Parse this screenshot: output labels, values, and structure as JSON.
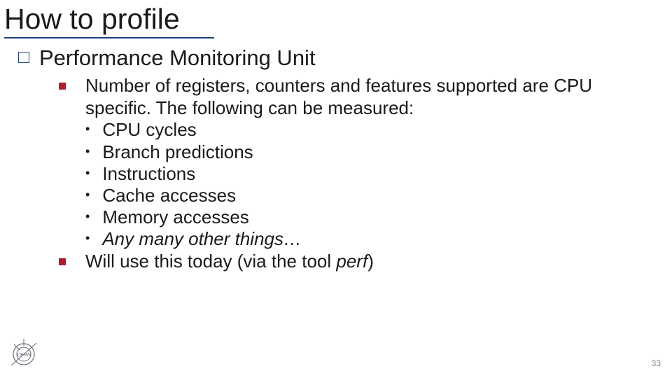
{
  "title": "How to profile",
  "bullets": {
    "lvl1": {
      "text": "Performance Monitoring Unit"
    },
    "lvl2": [
      {
        "text": "Number of registers, counters and features supported are CPU specific. The following can be measured:",
        "sub": [
          {
            "text": "CPU cycles"
          },
          {
            "text": "Branch predictions"
          },
          {
            "text": "Instructions"
          },
          {
            "text": "Cache accesses"
          },
          {
            "text": "Memory accesses"
          },
          {
            "text_italic": "Any many other things…"
          }
        ]
      },
      {
        "text_prefix": "Will use this today (via the tool ",
        "text_italic": "perf",
        "text_suffix": ")"
      }
    ]
  },
  "logo_label": "CERN",
  "page_number": "33"
}
